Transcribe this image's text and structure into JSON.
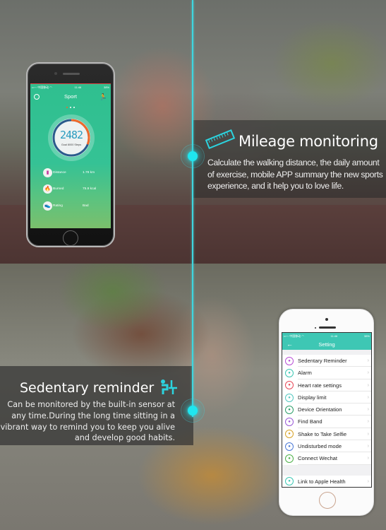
{
  "features": {
    "mileage": {
      "title": "Mileage monitoring",
      "description": "Calculate the walking distance, the daily amount of exercise, mobile APP summary  the new sports experience, and it help you to love life.",
      "icon": "ruler-icon"
    },
    "sedentary": {
      "title": "Sedentary reminder",
      "description": "Can be monitored by the built-in sensor at any time.During the long time sitting in a vibrant way to remind you to keep you alive and develop good habits.",
      "icon": "sitting-person-icon"
    }
  },
  "accent_color": "#2cd3de",
  "sport_app": {
    "status": {
      "carrier": "••◦◦◦ 中国移动 ◠",
      "time": "11:46",
      "battery": "38%"
    },
    "title": "Sport",
    "page_dots": 3,
    "active_dot": 0,
    "steps": "2482",
    "goal": "Goal 8000 Steps",
    "progress_fraction": 0.31,
    "stats": [
      {
        "icon": "ruler-icon",
        "label": "Distance",
        "value": "1.78 km"
      },
      {
        "icon": "flame-icon",
        "label": "Burned",
        "value": "75.9 kcal"
      },
      {
        "icon": "shoe-icon",
        "label": "Rating",
        "value": "Bad"
      }
    ],
    "colors": {
      "background": "#35c295",
      "progress": "#f06a2a",
      "ring": "#2a5b8c"
    }
  },
  "setting_app": {
    "status": {
      "carrier": "••◦◦◦ 中国移动 ◠",
      "time": "11:46",
      "battery": "38%"
    },
    "title": "Setting",
    "back_label": "←",
    "items": [
      {
        "label": "Sedentary Reminder",
        "icon": "sitting-icon",
        "color": "#b84fd6"
      },
      {
        "label": "Alarm",
        "icon": "alarm-icon",
        "color": "#3ec7b4"
      },
      {
        "label": "Heart rate settings",
        "icon": "heart-rate-icon",
        "color": "#e84a5a"
      },
      {
        "label": "Display limit",
        "icon": "sun-icon",
        "color": "#54c8c0"
      },
      {
        "label": "Device Orientation",
        "icon": "orientation-icon",
        "color": "#2e9e6a"
      },
      {
        "label": "Find Band",
        "icon": "search-icon",
        "color": "#9a5ad6"
      },
      {
        "label": "Shake to Take Selfie",
        "icon": "camera-icon",
        "color": "#d8a32a"
      },
      {
        "label": "Undisturbed mode",
        "icon": "moon-icon",
        "color": "#4a78d6"
      },
      {
        "label": "Connect Wechat",
        "icon": "wechat-icon",
        "color": "#4fb24a"
      }
    ],
    "footer_items": [
      {
        "label": "Link to Apple Health",
        "icon": "link-icon",
        "color": "#3ec7b4"
      }
    ],
    "chevron": "›"
  }
}
